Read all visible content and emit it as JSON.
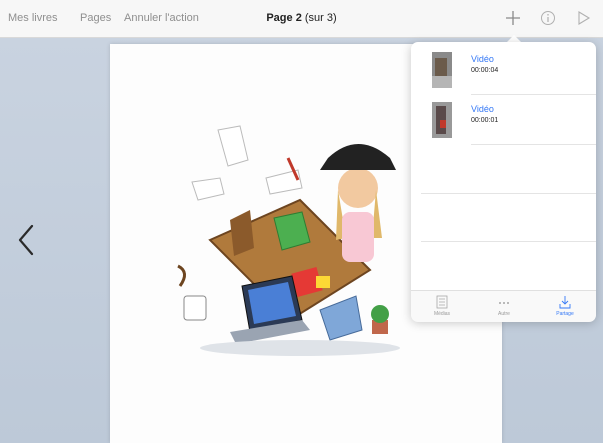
{
  "topbar": {
    "my_books": "Mes livres",
    "pages": "Pages",
    "undo": "Annuler l'action",
    "page_label": "Page 2",
    "page_suffix": "(sur 3)"
  },
  "icons": {
    "add": "plus-icon",
    "info": "info-icon",
    "play": "play-icon",
    "prev": "chevron-left-icon"
  },
  "media": {
    "items": [
      {
        "title": "Vidéo",
        "duration": "00:00:04"
      },
      {
        "title": "Vidéo",
        "duration": "00:00:01"
      }
    ],
    "tabs": [
      {
        "label": "Médias",
        "icon": "list-icon"
      },
      {
        "label": "Autre",
        "icon": "more-icon"
      },
      {
        "label": "Partage",
        "icon": "share-icon"
      }
    ]
  },
  "colors": {
    "accent": "#3478f6",
    "canvas": "#c6d1de"
  }
}
